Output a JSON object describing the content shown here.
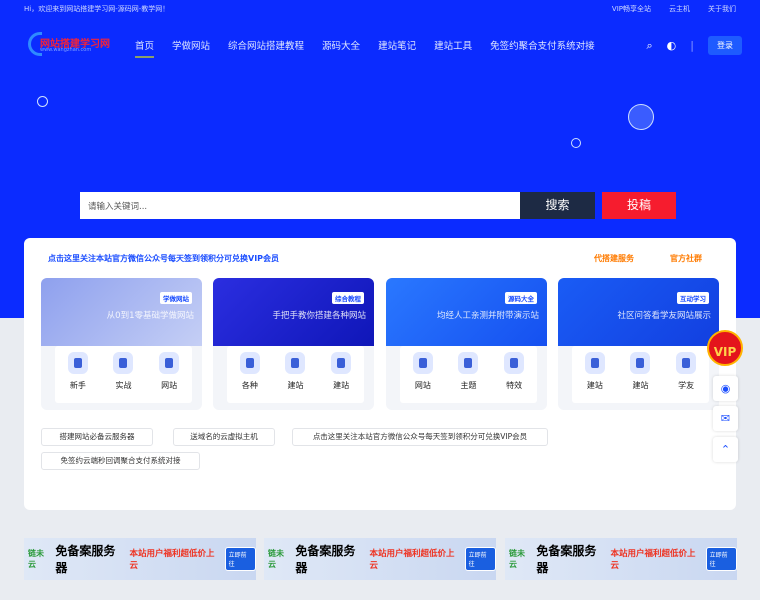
{
  "topbar": {
    "welcome": "Hi，欢迎来到网站搭建学习网-源码网-教学网！",
    "links": [
      "VIP畅享全站",
      "云主机",
      "关于我们"
    ]
  },
  "logo": {
    "text": "网站搭建学习网",
    "sub": "www.wangzhan.com"
  },
  "nav": [
    "首页",
    "学做网站",
    "综合网站搭建教程",
    "源码大全",
    "建站笔记",
    "建站工具",
    "免签约聚合支付系统对接"
  ],
  "header": {
    "login": "登录"
  },
  "search": {
    "placeholder": "请输入关键词...",
    "search_label": "搜索",
    "submit_label": "投稿"
  },
  "notice": "点击这里关注本站官方微信公众号每天签到领积分可兑换VIP会员",
  "services": [
    "代搭建服务",
    "官方社群"
  ],
  "cards": [
    {
      "tag": "学做网站",
      "sub": "从0到1零基础学做网站",
      "items": [
        "新手",
        "实战",
        "网站"
      ],
      "color": "#a9b7f0"
    },
    {
      "tag": "综合教程",
      "sub": "手把手教你搭建各种网站",
      "items": [
        "各种",
        "建站",
        "建站"
      ],
      "color": "#1a22d8"
    },
    {
      "tag": "源码大全",
      "sub": "均经人工亲测并附带演示站",
      "items": [
        "网站",
        "主题",
        "特效"
      ],
      "color": "#1f63f5"
    },
    {
      "tag": "互动学习",
      "sub": "社区问答看学友网站展示",
      "items": [
        "建站",
        "建站",
        "学友"
      ],
      "color": "#1a4ef0"
    }
  ],
  "links": [
    "搭建网站必备云服务器",
    "送域名的云虚拟主机",
    "点击这里关注本站官方微信公众号每天签到领积分可兑换VIP会员",
    "免签约云端秒回调聚合支付系统对接"
  ],
  "ads": [
    {
      "brand": "链未云",
      "main": "免备案服务器",
      "promo": "本站用户福利超低价上云",
      "go": "立即前往"
    },
    {
      "brand": "链未云",
      "main": "免备案服务器",
      "promo": "本站用户福利超低价上云",
      "go": "立即前往"
    },
    {
      "brand": "链未云",
      "main": "免备案服务器",
      "promo": "本站用户福利超低价上云",
      "go": "立即前往"
    }
  ],
  "float": {
    "vip": "VIP"
  }
}
